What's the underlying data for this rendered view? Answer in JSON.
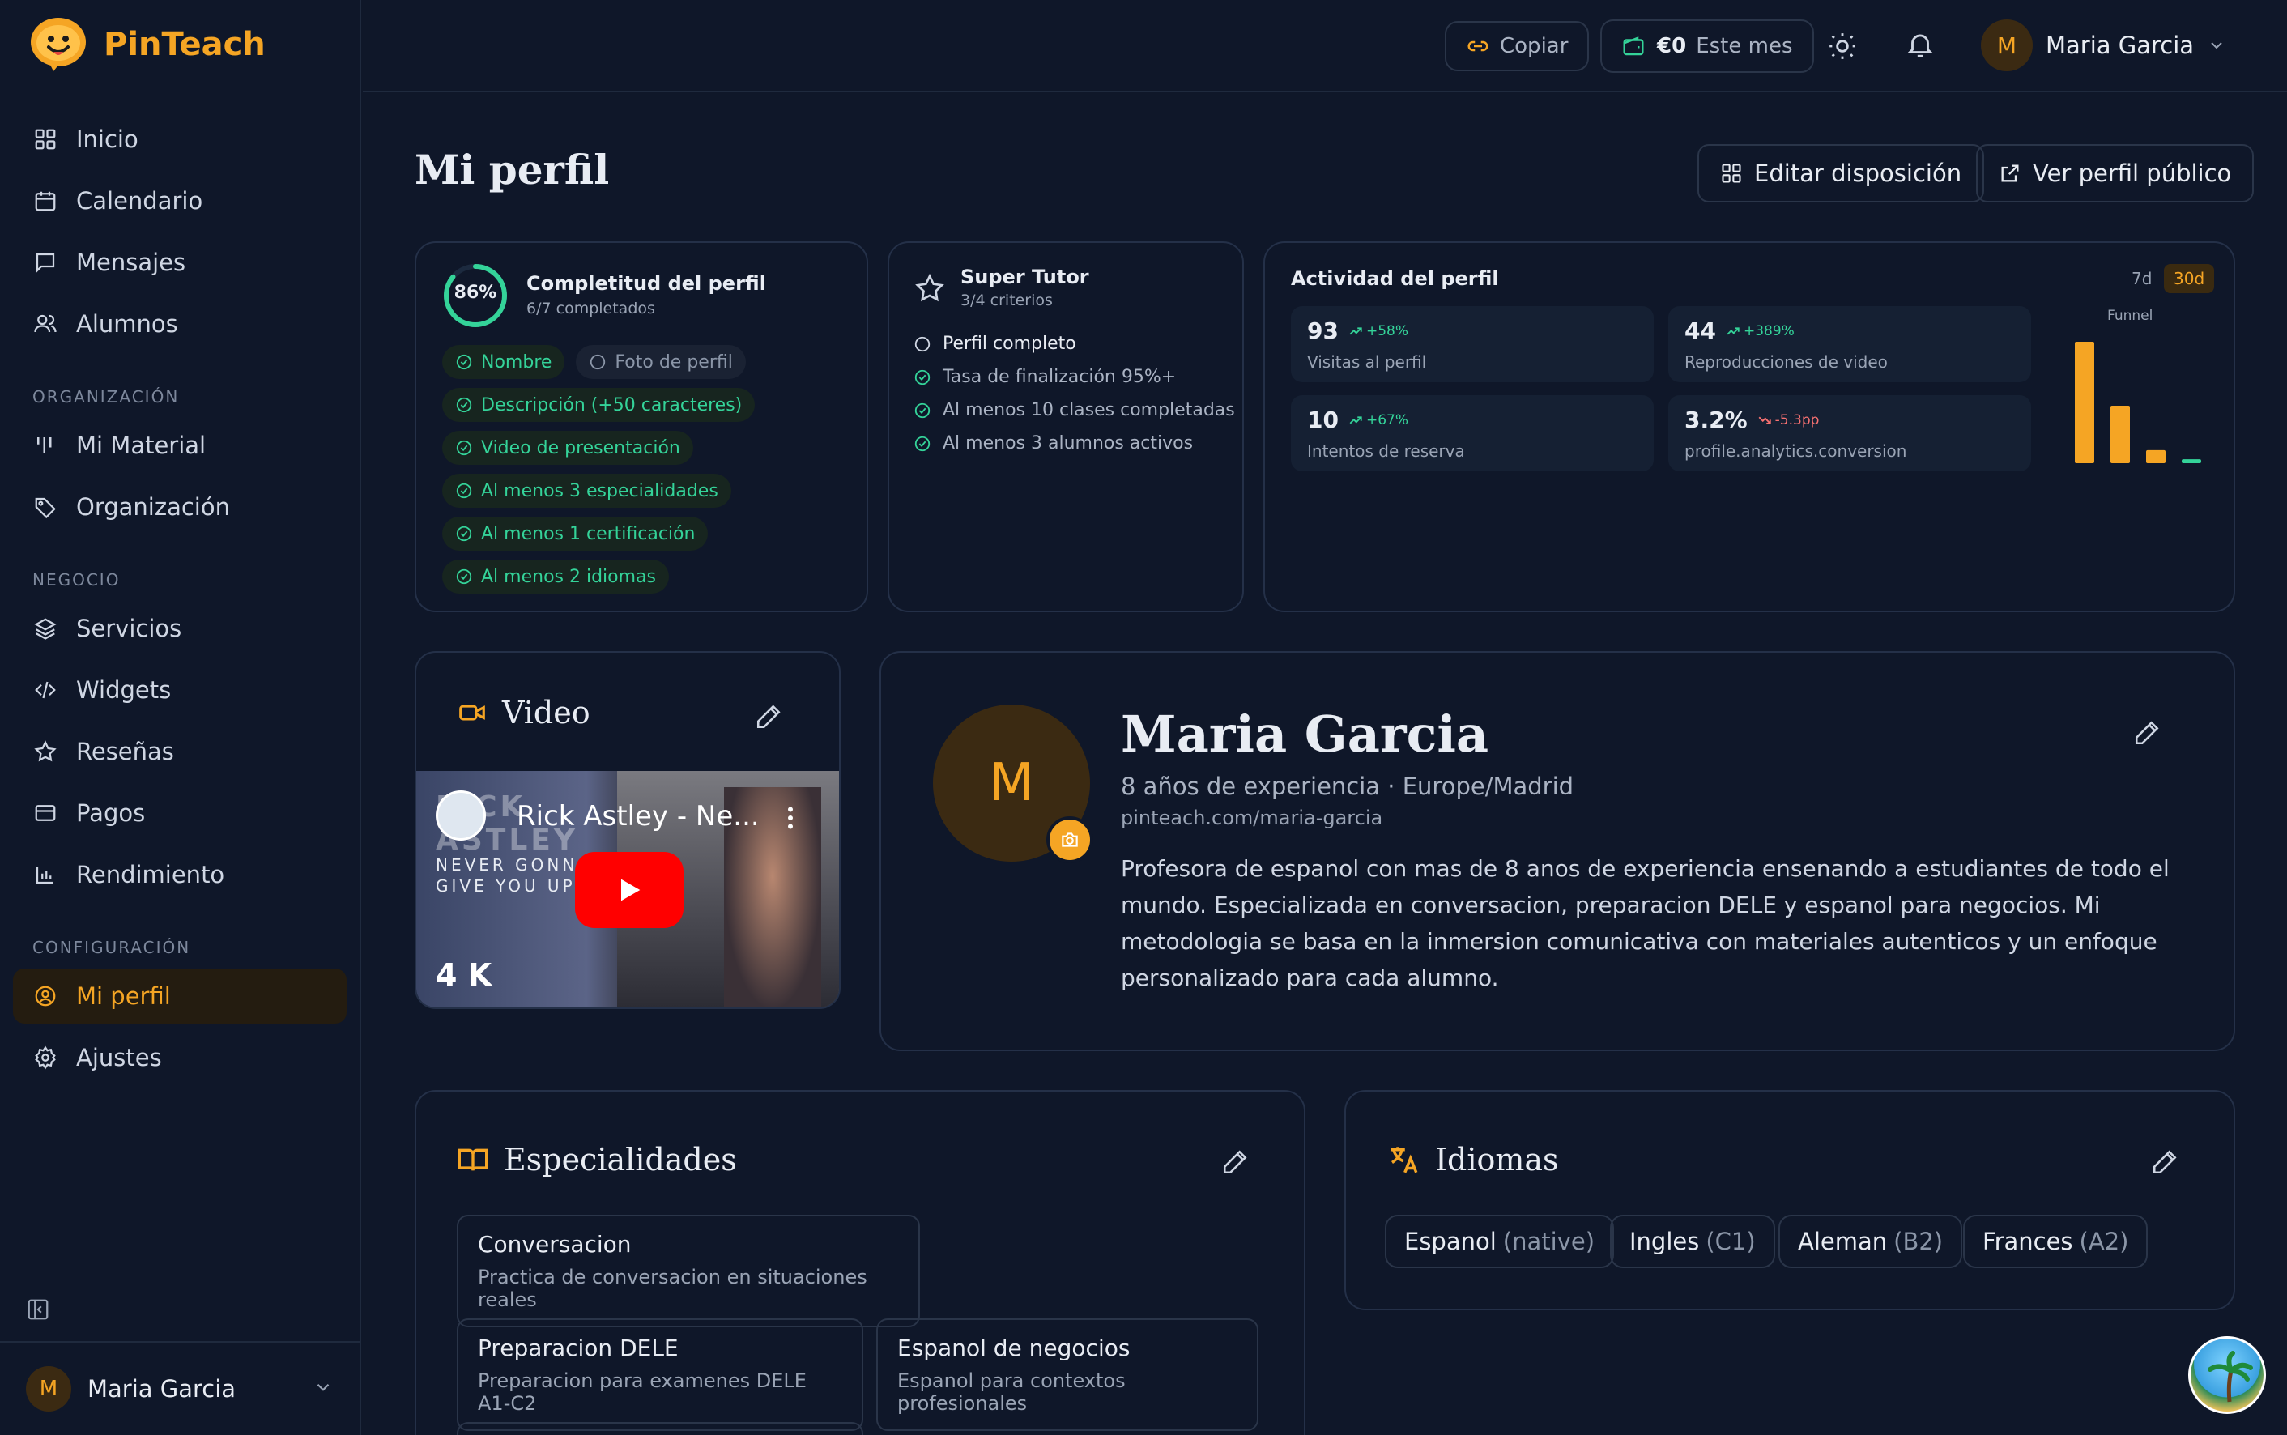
{
  "app": {
    "name": "PinTeach"
  },
  "sidebar": {
    "items_main": [
      {
        "label": "Inicio",
        "icon": "grid-icon"
      },
      {
        "label": "Calendario",
        "icon": "calendar-icon"
      },
      {
        "label": "Mensajes",
        "icon": "message-icon"
      },
      {
        "label": "Alumnos",
        "icon": "users-icon"
      }
    ],
    "section_org": "ORGANIZACIÓN",
    "items_org": [
      {
        "label": "Mi Material",
        "icon": "material-icon"
      },
      {
        "label": "Organización",
        "icon": "tag-icon"
      }
    ],
    "section_business": "NEGOCIO",
    "items_business": [
      {
        "label": "Servicios",
        "icon": "layers-icon"
      },
      {
        "label": "Widgets",
        "icon": "code-icon"
      },
      {
        "label": "Reseñas",
        "icon": "star-icon"
      },
      {
        "label": "Pagos",
        "icon": "card-icon"
      },
      {
        "label": "Rendimiento",
        "icon": "bar-chart-icon"
      }
    ],
    "section_config": "CONFIGURACIÓN",
    "items_config": [
      {
        "label": "Mi perfil",
        "icon": "user-circle-icon",
        "active": true
      },
      {
        "label": "Ajustes",
        "icon": "gear-icon"
      }
    ],
    "user": {
      "initial": "M",
      "name": "Maria Garcia"
    }
  },
  "topbar": {
    "copy_label": "Copiar",
    "earnings_value": "€0",
    "earnings_label": "Este mes",
    "user_initial": "M",
    "user_name": "Maria Garcia"
  },
  "page": {
    "title": "Mi perfil",
    "edit_layout_label": "Editar disposición",
    "public_profile_label": "Ver perfil público"
  },
  "completeness": {
    "percent_label": "86%",
    "percent": 86,
    "title": "Completitud del perfil",
    "subtitle": "6/7 completados",
    "chips": [
      {
        "label": "Nombre",
        "done": true
      },
      {
        "label": "Foto de perfil",
        "done": false
      },
      {
        "label": "Descripción (+50 caracteres)",
        "done": true
      },
      {
        "label": "Video de presentación",
        "done": true
      },
      {
        "label": "Al menos 3 especialidades",
        "done": true
      },
      {
        "label": "Al menos 1 certificación",
        "done": true
      },
      {
        "label": "Al menos 2 idiomas",
        "done": true
      }
    ]
  },
  "super_tutor": {
    "title": "Super Tutor",
    "subtitle": "3/4 criterios",
    "criteria": [
      {
        "label": "Perfil completo",
        "done": false
      },
      {
        "label": "Tasa de finalización 95%+",
        "done": true
      },
      {
        "label": "Al menos 10 clases completadas",
        "done": true
      },
      {
        "label": "Al menos 3 alumnos activos",
        "done": true
      }
    ]
  },
  "activity": {
    "title": "Actividad del perfil",
    "range_7d": "7d",
    "range_30d": "30d",
    "funnel_label": "Funnel",
    "stats": [
      {
        "value": "93",
        "delta": "+58%",
        "trend": "up",
        "label": "Visitas al perfil"
      },
      {
        "value": "44",
        "delta": "+389%",
        "trend": "up",
        "label": "Reproducciones de video"
      },
      {
        "value": "10",
        "delta": "+67%",
        "trend": "up",
        "label": "Intentos de reserva"
      },
      {
        "value": "3.2%",
        "delta": "-5.3pp",
        "trend": "down",
        "label": "profile.analytics.conversion"
      }
    ],
    "funnel_values": [
      93,
      44,
      10,
      3
    ]
  },
  "video": {
    "title": "Video",
    "video_title": "Rick Astley - Ne...",
    "overlay_line1": "NEVER GONNA",
    "overlay_line2": "GIVE YOU UP",
    "overlay_brand": "RICK ASTLEY",
    "quality": "4 K"
  },
  "profile": {
    "initial": "M",
    "name": "Maria Garcia",
    "meta": "8 años de experiencia · Europe/Madrid",
    "url": "pinteach.com/maria-garcia",
    "bio": "Profesora de espanol con mas de 8 anos de experiencia ensenando a estudiantes de todo el mundo. Especializada en conversacion, preparacion DELE y espanol para negocios. Mi metodologia se basa en la inmersion comunicativa con materiales autenticos y un enfoque personalizado para cada alumno."
  },
  "specialties": {
    "title": "Especialidades",
    "items": [
      {
        "name": "Conversacion",
        "desc": "Practica de conversacion en situaciones reales"
      },
      {
        "name": "Preparacion DELE",
        "desc": "Preparacion para examenes DELE A1-C2"
      },
      {
        "name": "Espanol de negocios",
        "desc": "Espanol para contextos profesionales"
      }
    ]
  },
  "languages": {
    "title": "Idiomas",
    "items": [
      {
        "name": "Espanol",
        "level": "(native)"
      },
      {
        "name": "Ingles",
        "level": "(C1)"
      },
      {
        "name": "Aleman",
        "level": "(B2)"
      },
      {
        "name": "Frances",
        "level": "(A2)"
      }
    ]
  },
  "colors": {
    "accent": "#f5a524",
    "success": "#34d399",
    "danger": "#f87171",
    "background": "#0f1729"
  }
}
